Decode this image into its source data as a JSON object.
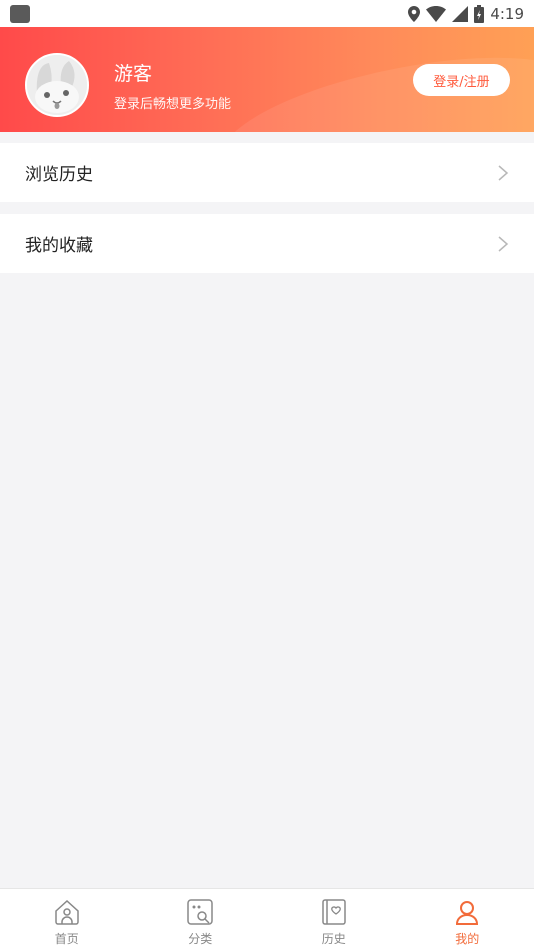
{
  "status_bar": {
    "time": "4:19",
    "icons": [
      "app-icon",
      "location-icon",
      "wifi-icon",
      "signal-icon",
      "battery-icon"
    ]
  },
  "header": {
    "username": "游客",
    "subtitle": "登录后畅想更多功能",
    "login_button": "登录/注册",
    "gradient_colors": [
      "#ff4a4a",
      "#ffa055"
    ]
  },
  "menu": {
    "items": [
      {
        "label": "浏览历史",
        "icon": "chevron-right-icon"
      },
      {
        "label": "我的收藏",
        "icon": "chevron-right-icon"
      }
    ]
  },
  "bottom_nav": {
    "items": [
      {
        "label": "首页",
        "icon": "home-icon"
      },
      {
        "label": "分类",
        "icon": "category-icon"
      },
      {
        "label": "历史",
        "icon": "history-book-icon"
      },
      {
        "label": "我的",
        "icon": "profile-icon",
        "active": true
      }
    ],
    "active_color": "#f26b3a"
  }
}
